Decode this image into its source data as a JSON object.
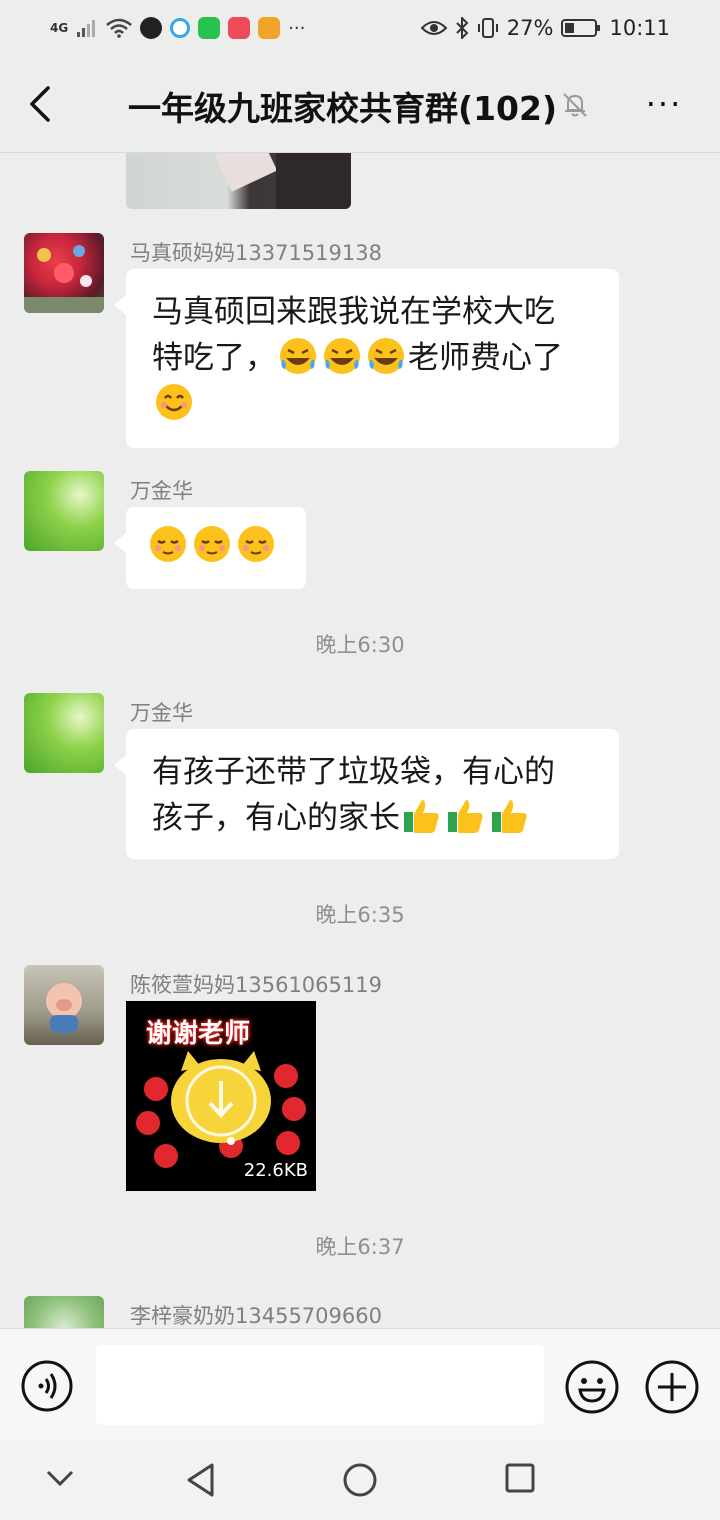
{
  "status_bar": {
    "network": "4G",
    "battery": "27%",
    "time": "10:11",
    "dots": "···"
  },
  "header": {
    "title": "一年级九班家校共育群(102)",
    "more": "···"
  },
  "messages": [
    {
      "sender": "马真硕妈妈13371519138",
      "line1": "马真硕回来跟我说在学校大吃",
      "line2a": "特吃了，",
      "line2b": "老师费心了"
    },
    {
      "sender": "万金华"
    },
    {
      "time": "晚上6:30"
    },
    {
      "sender": "万金华",
      "line1": "有孩子还带了垃圾袋，有心的",
      "line2": "孩子，有心的家长"
    },
    {
      "time": "晚上6:35"
    },
    {
      "sender": "陈筱萱妈妈13561065119",
      "sticker_text": "谢谢老师",
      "sticker_size": "22.6KB"
    },
    {
      "time": "晚上6:37"
    },
    {
      "sender": "李梓豪奶奶13455709660"
    }
  ],
  "colors": {
    "background": "#ededed",
    "bubble": "#ffffff",
    "meta_text": "#8f8f8f"
  }
}
